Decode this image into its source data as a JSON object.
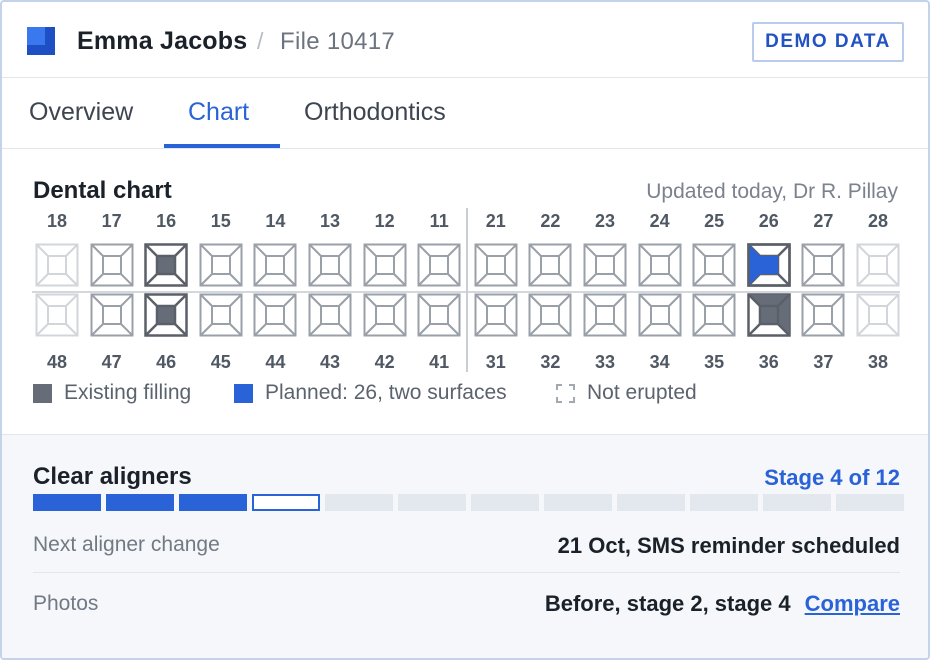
{
  "header": {
    "patient_name": "Emma Jacobs",
    "separator": "/",
    "file_label": "File 10417",
    "badge": "DEMO DATA",
    "brand_color": "#2a62d8"
  },
  "tabs": [
    {
      "label": "Overview",
      "active": false
    },
    {
      "label": "Chart",
      "active": true
    },
    {
      "label": "Orthodontics",
      "active": false
    }
  ],
  "dental_chart": {
    "title": "Dental chart",
    "updated": "Updated today, Dr R. Pillay",
    "upper_teeth": [
      "18",
      "17",
      "16",
      "15",
      "14",
      "13",
      "12",
      "11",
      "21",
      "22",
      "23",
      "24",
      "25",
      "26",
      "27",
      "28"
    ],
    "lower_teeth": [
      "48",
      "47",
      "46",
      "45",
      "44",
      "43",
      "42",
      "41",
      "31",
      "32",
      "33",
      "34",
      "35",
      "36",
      "37",
      "38"
    ],
    "tooth_states": {
      "18": "not-erupted",
      "28": "not-erupted",
      "48": "not-erupted",
      "38": "not-erupted",
      "16": "existing-filling",
      "46": "existing-filling",
      "26": "planned",
      "36": "existing-filling-mesial"
    },
    "legend": [
      {
        "label": "Existing filling",
        "kind": "existing"
      },
      {
        "label": "Planned: 26, two surfaces",
        "kind": "planned"
      },
      {
        "label": "Not erupted",
        "kind": "not-erupted"
      }
    ],
    "colors": {
      "existing": "#666d78",
      "planned": "#2a62d8",
      "outline": "#9aa0a8",
      "not_erupted": "#d2d6db"
    }
  },
  "aligners": {
    "title": "Clear aligners",
    "stage_text": "Stage 4 of 12",
    "current_stage": 4,
    "total_stages": 12,
    "rows": [
      {
        "label": "Next aligner change",
        "value": "21 Oct, SMS reminder scheduled"
      },
      {
        "label": "Photos",
        "value": "Before, stage 2, stage 4",
        "link": "Compare"
      }
    ]
  }
}
